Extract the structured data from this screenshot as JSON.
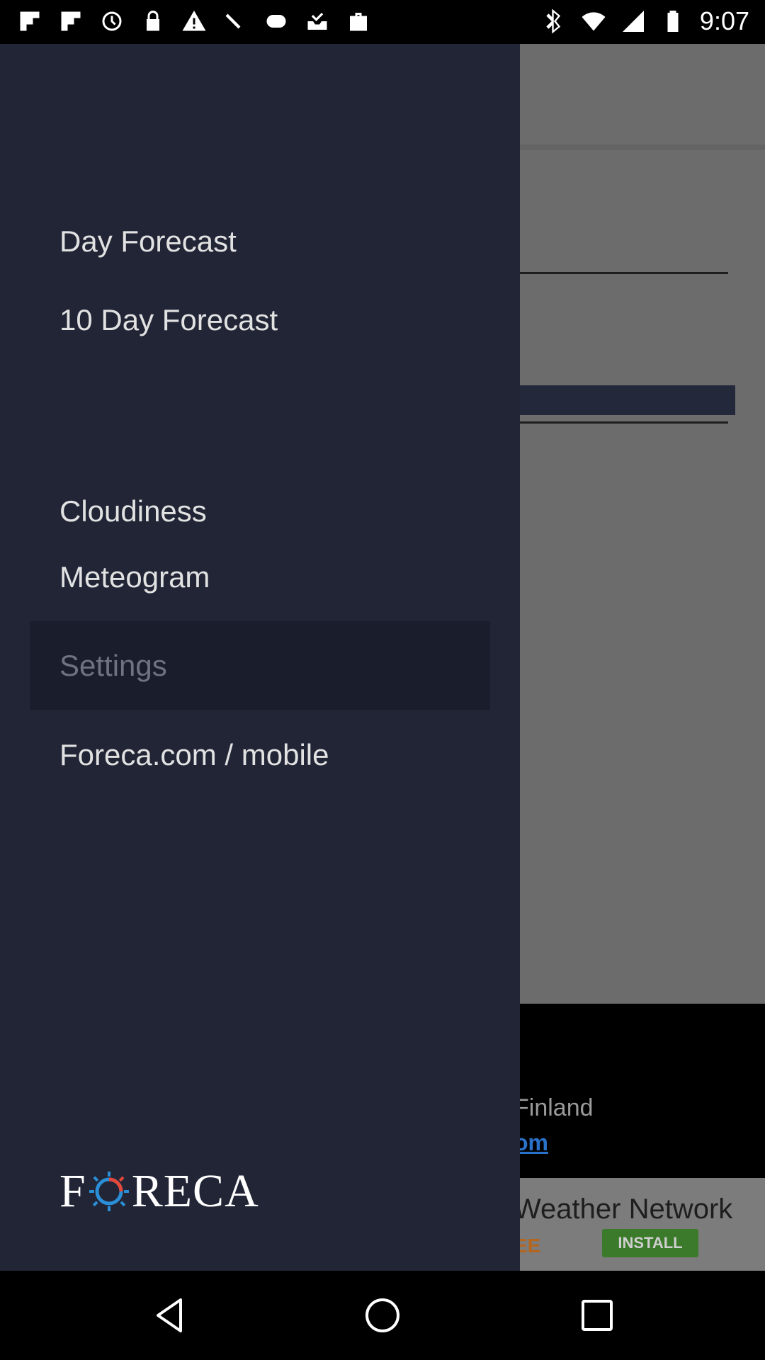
{
  "status_bar": {
    "time": "9:07",
    "icons": [
      "flipboard-icon",
      "flipboard-icon",
      "sync-icon",
      "lock-icon",
      "warning-icon",
      "satellite-icon",
      "game-controller-icon",
      "inbox-check-icon",
      "shopping-bag-icon",
      "bluetooth-icon",
      "wifi-icon",
      "signal-icon",
      "battery-icon"
    ]
  },
  "drawer": {
    "items": [
      {
        "label": "Day Forecast"
      },
      {
        "label": "10 Day Forecast"
      },
      {
        "label": "Cloudiness"
      },
      {
        "label": "Meteogram"
      },
      {
        "label": "Settings",
        "selected": true
      },
      {
        "label": "Foreca.com / mobile"
      }
    ],
    "logo_text": "FORECA"
  },
  "background": {
    "ad_text_1": "Finland",
    "ad_text_2": "om",
    "ad_banner_title": "Weather Network",
    "ad_banner_free": "EE",
    "ad_install": "INSTALL"
  },
  "nav_bar": {
    "buttons": [
      "back",
      "home",
      "recent-apps"
    ]
  },
  "colors": {
    "drawer_bg": "#212536",
    "selected_bg": "#1a1d2b",
    "scrim": "#6c6c6c",
    "install_green": "#3a7a2a",
    "logo_sun": "#2a8fd6"
  }
}
